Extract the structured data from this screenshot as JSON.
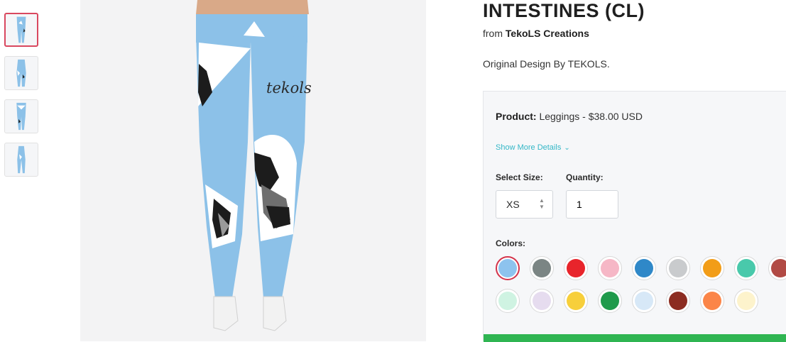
{
  "thumbnails": [
    {
      "name": "thumb-front",
      "active": true
    },
    {
      "name": "thumb-side",
      "active": false
    },
    {
      "name": "thumb-back",
      "active": false
    },
    {
      "name": "thumb-other",
      "active": false
    }
  ],
  "hero": {
    "brand_print": "tekols"
  },
  "product": {
    "title": "INTESTINES (CL)",
    "from_prefix": "from",
    "creator": "TekoLS Creations",
    "description": "Original Design By TEKOLS.",
    "product_label": "Product:",
    "product_value": "Leggings - $38.00 USD",
    "show_more": "Show More Details",
    "size_label": "Select Size:",
    "size_value": "XS",
    "quantity_label": "Quantity:",
    "quantity_value": "1",
    "colors_label": "Colors:"
  },
  "colors": {
    "row1": [
      "#8dc3ee",
      "#7b8584",
      "#e8242b",
      "#f6b7c6",
      "#2f88c8",
      "#c9cbcd",
      "#f29d18",
      "#49c9ab",
      "#b14a44"
    ],
    "row2": [
      "#cff3e2",
      "#e6dcef",
      "#f7cf3b",
      "#1f9a4b",
      "#d7e8f7",
      "#8c2c21",
      "#fb8548",
      "#fdf3cc"
    ],
    "selected_index": 0
  },
  "accent_colors": {
    "legging_blue": "#8cc1e8",
    "buy_green": "#2fb552",
    "link_teal": "#34b7c7",
    "selected_red": "#d4344b"
  }
}
